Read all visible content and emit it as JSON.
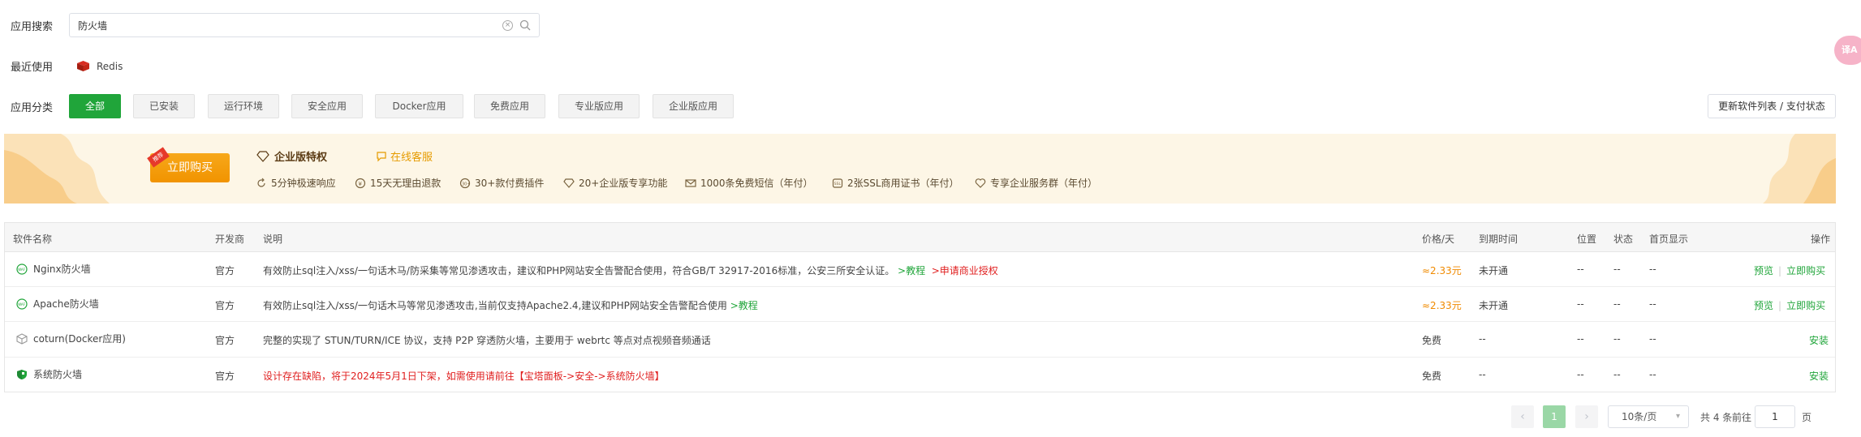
{
  "search": {
    "label": "应用搜索",
    "value": "防火墙"
  },
  "recent": {
    "label": "最近使用",
    "items": [
      {
        "name": "Redis"
      }
    ]
  },
  "categories": {
    "label": "应用分类",
    "items": [
      "全部",
      "已安装",
      "运行环境",
      "安全应用",
      "Docker应用",
      "免费应用",
      "专业版应用",
      "企业版应用"
    ],
    "active": "全部",
    "update_button": "更新软件列表 / 支付状态"
  },
  "banner": {
    "buy_label": "立即购买",
    "ribbon": "推荐",
    "title": "企业版特权",
    "service": "在线客服",
    "features": [
      "5分钟极速响应",
      "15天无理由退款",
      "30+款付费插件",
      "20+企业版专享功能",
      "1000条免费短信（年付）",
      "2张SSL商用证书（年付）",
      "专享企业服务群（年付）"
    ]
  },
  "table": {
    "headers": [
      "软件名称",
      "开发商",
      "说明",
      "价格/天",
      "到期时间",
      "位置",
      "状态",
      "首页显示",
      "操作"
    ],
    "rows": [
      {
        "name": "Nginx防火墙",
        "developer": "官方",
        "description": "有效防止sql注入/xss/一句话木马/防采集等常见渗透攻击，建议和PHP网站安全告警配合使用，符合GB/T 32917-2016标准，公安三所安全认证。",
        "link_tutorial": ">教程",
        "link_license": ">申请商业授权",
        "price": "≈2.33元",
        "expire": "未开通",
        "location": "--",
        "status": "--",
        "home": "--",
        "ops": [
          "预览",
          "立即购买"
        ]
      },
      {
        "name": "Apache防火墙",
        "developer": "官方",
        "description": "有效防止sql注入/xss/一句话木马等常见渗透攻击,当前仅支持Apache2.4,建议和PHP网站安全告警配合使用",
        "link_tutorial": ">教程",
        "price": "≈2.33元",
        "expire": "未开通",
        "location": "--",
        "status": "--",
        "home": "--",
        "ops": [
          "预览",
          "立即购买"
        ]
      },
      {
        "name": "coturn(Docker应用)",
        "developer": "官方",
        "description": "完整的实现了 STUN/TURN/ICE 协议，支持 P2P 穿透防火墙，主要用于 webrtc 等点对点视频音频通话",
        "price": "免费",
        "expire": "--",
        "location": "--",
        "status": "--",
        "home": "--",
        "ops": [
          "安装"
        ]
      },
      {
        "name": "系统防火墙",
        "developer": "官方",
        "description": "设计存在缺陷，将于2024年5月1日下架，如需使用请前往【宝塔面板->安全->系统防火墙】",
        "price": "免费",
        "expire": "--",
        "location": "--",
        "status": "--",
        "home": "--",
        "ops": [
          "安装"
        ]
      }
    ]
  },
  "pagination": {
    "current": "1",
    "page_size": "10条/页",
    "total": "共 4 条",
    "goto_label": "前往",
    "goto_value": "1",
    "page_unit": "页"
  },
  "colors": {
    "primary": "#20a53a",
    "price": "#f08a00",
    "danger": "#e02020",
    "banner_bg": "#fdf6e6"
  },
  "float_button": {
    "label": "译A"
  }
}
